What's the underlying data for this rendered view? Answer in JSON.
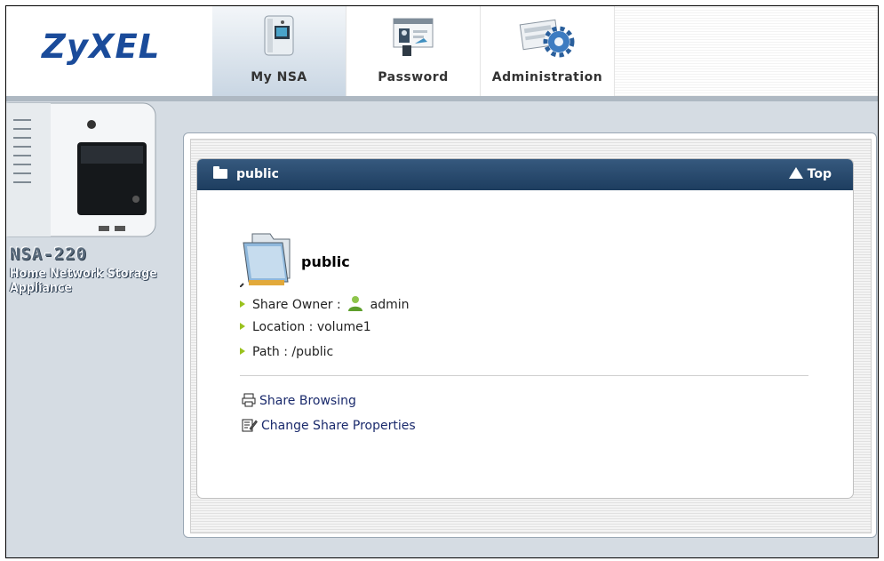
{
  "brand": {
    "logo": "ZyXEL",
    "model": "NSA-220",
    "description": "Home Network Storage Appliance"
  },
  "nav": [
    {
      "label": "My NSA",
      "icon": "nsa-device-icon",
      "active": true
    },
    {
      "label": "Password",
      "icon": "password-card-icon",
      "active": false
    },
    {
      "label": "Administration",
      "icon": "administration-gear-icon",
      "active": false
    }
  ],
  "card": {
    "header_title": "public",
    "top_label": "Top",
    "share_name": "public",
    "owner_label": "Share Owner :",
    "owner_value": "admin",
    "location": "Location : volume1",
    "path": "Path : /public",
    "links": {
      "browse": "Share Browsing",
      "change": "Change Share Properties"
    }
  },
  "colors": {
    "brand_blue": "#1a4b9a",
    "card_header": "#2a4d72",
    "bullet_green": "#9ac21e",
    "link": "#1a2a6c"
  }
}
